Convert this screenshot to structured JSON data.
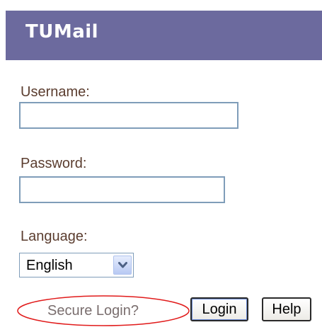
{
  "header": {
    "title": "TUMail",
    "bg_color": "#6c6a9e"
  },
  "form": {
    "username_label": "Username:",
    "username_value": "",
    "password_label": "Password:",
    "password_value": "",
    "language_label": "Language:",
    "language_selected": "English",
    "language_dropdown_icon": "chevron-down-icon"
  },
  "secure_login": {
    "text": "Secure Login?",
    "highlight_color": "#e11b1b"
  },
  "buttons": {
    "login": "Login",
    "help": "Help"
  },
  "colors": {
    "label_text": "#5b3d2f",
    "input_border": "#7f9db9"
  }
}
